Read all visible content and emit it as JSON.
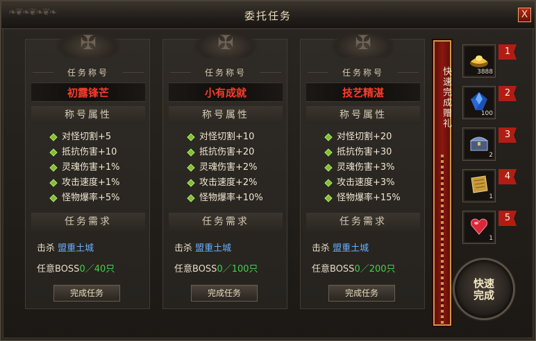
{
  "window": {
    "title": "委托任务",
    "close_label": "X"
  },
  "tasks": [
    {
      "header": "任务称号",
      "name": "初露锋芒",
      "attr_header": "称号属性",
      "attributes": [
        "对怪切割+5",
        "抵抗伤害+10",
        "灵魂伤害+1%",
        "攻击速度+1%",
        "怪物爆率+5%"
      ],
      "req_header": "任务需求",
      "kill_label": "击杀",
      "kill_target": "盟重土城",
      "boss_label": "任意BOSS",
      "boss_count": "0／40只",
      "button": "完成任务"
    },
    {
      "header": "任务称号",
      "name": "小有成就",
      "attr_header": "称号属性",
      "attributes": [
        "对怪切割+10",
        "抵抗伤害+20",
        "灵魂伤害+2%",
        "攻击速度+2%",
        "怪物爆率+10%"
      ],
      "req_header": "任务需求",
      "kill_label": "击杀",
      "kill_target": "盟重土城",
      "boss_label": "任意BOSS",
      "boss_count": "0／100只",
      "button": "完成任务"
    },
    {
      "header": "任务称号",
      "name": "技艺精湛",
      "attr_header": "称号属性",
      "attributes": [
        "对怪切割+20",
        "抵抗伤害+30",
        "灵魂伤害+3%",
        "攻击速度+3%",
        "怪物爆率+15%"
      ],
      "req_header": "任务需求",
      "kill_label": "击杀",
      "kill_target": "盟重土城",
      "boss_label": "任意BOSS",
      "boss_count": "0／200只",
      "button": "完成任务"
    }
  ],
  "gift_banner": "快速完成赠礼",
  "rewards": [
    {
      "rank": "1",
      "icon": "gold-ingot-icon",
      "qty": "3888",
      "color": "#d9a62a"
    },
    {
      "rank": "2",
      "icon": "blue-gem-icon",
      "qty": "100",
      "color": "#2f6fd6"
    },
    {
      "rank": "3",
      "icon": "treasure-chest-icon",
      "qty": "2",
      "color": "#6f8fc0"
    },
    {
      "rank": "4",
      "icon": "gold-scroll-icon",
      "qty": "1",
      "color": "#c89a3a"
    },
    {
      "rank": "5",
      "icon": "red-heart-gem-icon",
      "qty": "1",
      "color": "#d8283a"
    }
  ],
  "quick_complete": "快速完成",
  "colors": {
    "title_name": "#ff3b2b",
    "kill_target": "#6ab0ff",
    "boss_count": "#3fd34a",
    "bullet": "#7fbf34"
  }
}
